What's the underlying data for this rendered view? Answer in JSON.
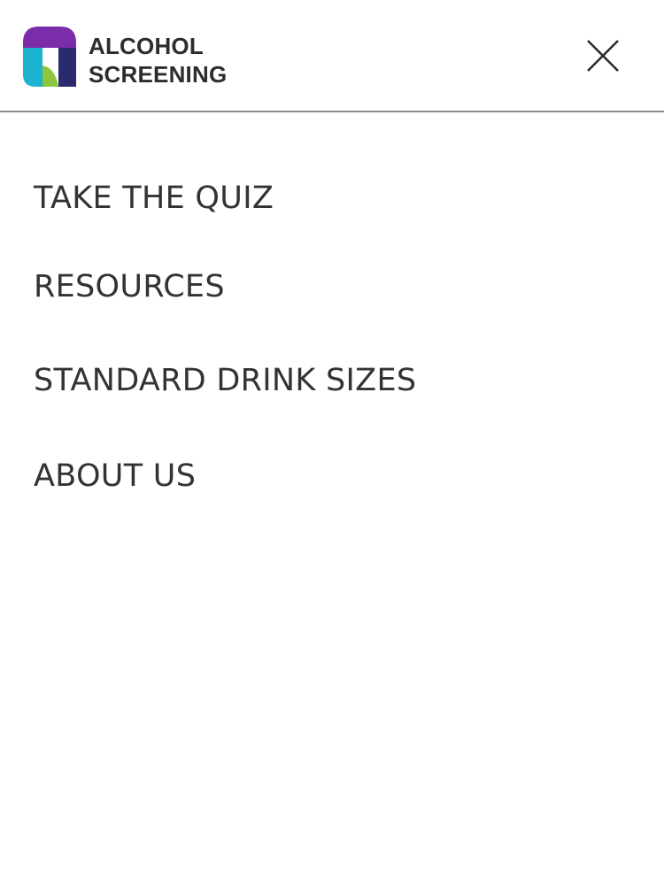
{
  "header": {
    "logo_line1": "ALCOHOL",
    "logo_line2": "SCREENING",
    "close_icon": "close-icon",
    "colors": {
      "logo_purple": "#7b2ca8",
      "logo_teal": "#1bb3cf",
      "logo_navy": "#2c2a6e",
      "logo_green": "#8cc63f"
    }
  },
  "nav": {
    "items": [
      {
        "label": "TAKE THE QUIZ"
      },
      {
        "label": "RESOURCES"
      },
      {
        "label": "STANDARD DRINK SIZES"
      },
      {
        "label": "ABOUT US"
      }
    ]
  }
}
